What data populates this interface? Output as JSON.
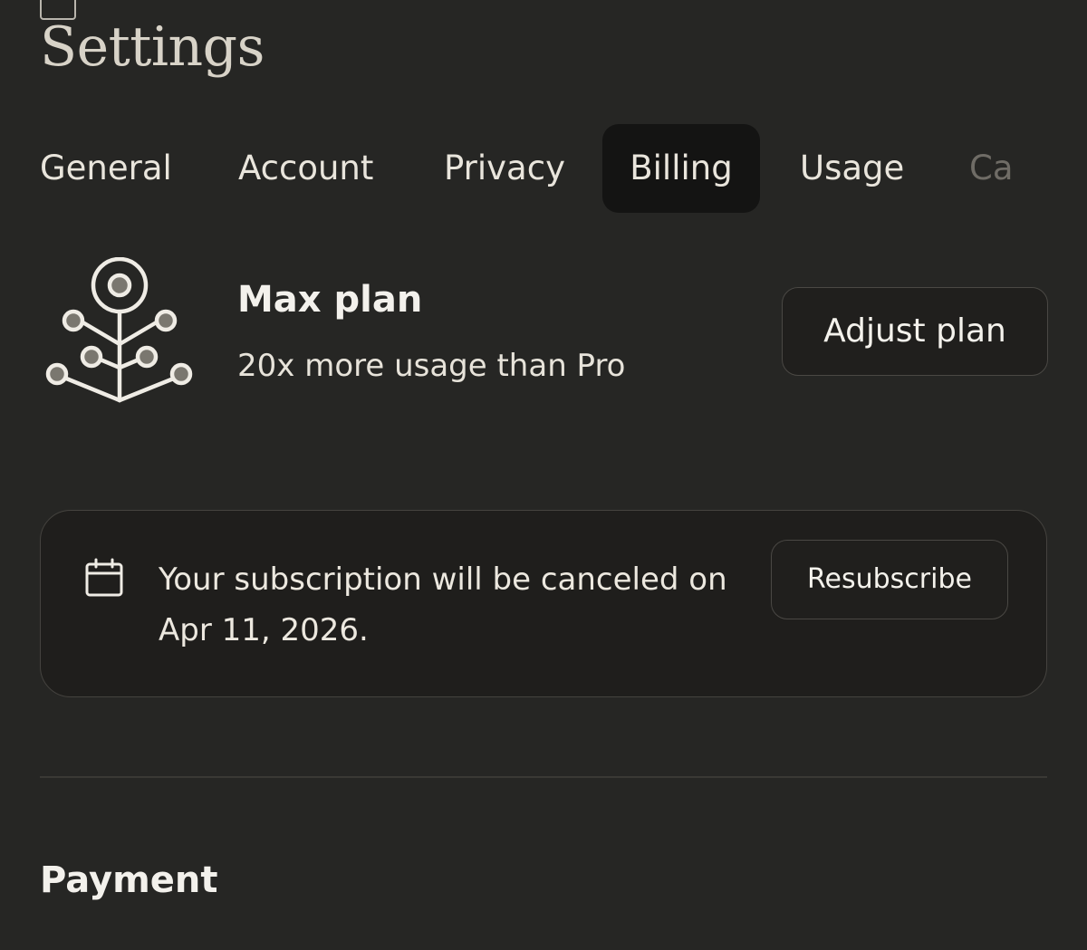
{
  "page": {
    "title": "Settings"
  },
  "tabs": [
    {
      "label": "General",
      "active": false
    },
    {
      "label": "Account",
      "active": false
    },
    {
      "label": "Privacy",
      "active": false
    },
    {
      "label": "Billing",
      "active": true
    },
    {
      "label": "Usage",
      "active": false
    },
    {
      "label": "Ca",
      "active": false
    }
  ],
  "plan": {
    "icon": "plan-tree-icon",
    "name": "Max plan",
    "description": "20x more usage than Pro",
    "adjust_label": "Adjust plan"
  },
  "subscription_notice": {
    "icon": "calendar-icon",
    "message": "Your subscription will be canceled on Apr 11, 2026.",
    "resubscribe_label": "Resubscribe"
  },
  "payment": {
    "title": "Payment"
  },
  "colors": {
    "background": "#262624",
    "active_tab": "#141413",
    "card": "#1f1e1c",
    "text": "#f2f0ea",
    "title_text": "#d8d3c8"
  }
}
